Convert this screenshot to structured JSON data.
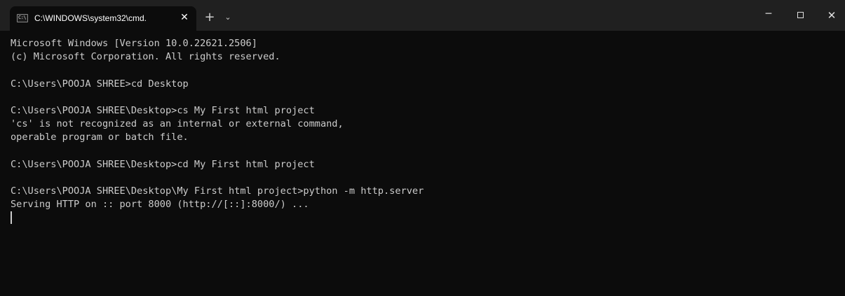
{
  "tab": {
    "icon_glyph": "C:\\",
    "title": "C:\\WINDOWS\\system32\\cmd.",
    "close_glyph": "✕",
    "new_tab_glyph": "+",
    "dropdown_glyph": "⌄"
  },
  "window_controls": {
    "minimize_glyph": "─",
    "close_glyph": "✕"
  },
  "terminal": {
    "lines": [
      "Microsoft Windows [Version 10.0.22621.2506]",
      "(c) Microsoft Corporation. All rights reserved.",
      "",
      "C:\\Users\\POOJA SHREE>cd Desktop",
      "",
      "C:\\Users\\POOJA SHREE\\Desktop>cs My First html project",
      "'cs' is not recognized as an internal or external command,",
      "operable program or batch file.",
      "",
      "C:\\Users\\POOJA SHREE\\Desktop>cd My First html project",
      "",
      "C:\\Users\\POOJA SHREE\\Desktop\\My First html project>python -m http.server",
      "Serving HTTP on :: port 8000 (http://[::]:8000/) ..."
    ]
  },
  "colors": {
    "background": "#0c0c0c",
    "titlebar": "#202020",
    "text": "#cccccc"
  }
}
